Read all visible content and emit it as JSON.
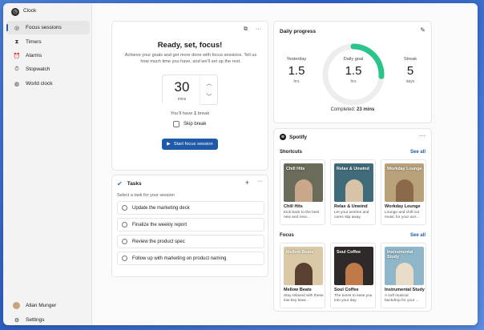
{
  "app": {
    "title": "Clock"
  },
  "window_controls": {
    "minimize": "–",
    "maximize": "□",
    "close": "✕"
  },
  "sidebar": {
    "items": [
      {
        "label": "Focus sessions",
        "icon": "focus-icon",
        "active": true
      },
      {
        "label": "Timers",
        "icon": "timer-icon"
      },
      {
        "label": "Alarms",
        "icon": "alarm-icon"
      },
      {
        "label": "Stopwatch",
        "icon": "stopwatch-icon"
      },
      {
        "label": "World clock",
        "icon": "globe-icon"
      }
    ],
    "user": {
      "name": "Allan Munger"
    },
    "settings_label": "Settings"
  },
  "focus": {
    "title": "Ready, set, focus!",
    "description": "Achieve your goals and get more done with focus sessions. Tell us how much time you have, and we'll set up the rest.",
    "duration_value": "30",
    "duration_unit": "mins",
    "break_text_prefix": "You'll have ",
    "break_count": "1",
    "break_text_suffix": " break",
    "skip_break_label": "Skip break",
    "start_label": "Start focus session"
  },
  "tasks": {
    "title": "Tasks",
    "subtitle": "Select a task for your session",
    "items": [
      "Update the marketing deck",
      "Finalize the weekly report",
      "Review the product spec",
      "Follow up with marketing on product naming"
    ]
  },
  "progress": {
    "title": "Daily progress",
    "yesterday_label": "Yesterday",
    "yesterday_value": "1.5",
    "yesterday_unit": "hrs",
    "goal_label": "Daily goal",
    "goal_value": "1.5",
    "goal_unit": "hrs",
    "streak_label": "Streak",
    "streak_value": "5",
    "streak_unit": "days",
    "completed_prefix": "Completed: ",
    "completed_value": "23 mins",
    "goal_fraction": 0.26,
    "ring_color": "#2bc48a"
  },
  "spotify": {
    "brand": "Spotify",
    "shortcuts_label": "Shortcuts",
    "focus_label": "Focus",
    "see_all": "See all",
    "shortcuts": [
      {
        "name": "Chill Hits",
        "art_title": "Chill Hits",
        "desc": "Kick back to the best new and rece...",
        "bg": "#6b6b5a",
        "fg": "#c9a78a"
      },
      {
        "name": "Relax & Unwind",
        "art_title": "Relax & Unwind",
        "desc": "Let your worries and cares slip away.",
        "bg": "#3f6b7a",
        "fg": "#d7c3a6"
      },
      {
        "name": "Workday Lounge",
        "art_title": "Workday Lounge",
        "desc": "Lounge and chill out music for your wor...",
        "bg": "#b9a27a",
        "fg": "#8a6a4a"
      }
    ],
    "focus_items": [
      {
        "name": "Mellow Beats",
        "art_title": "Mellow Beats",
        "desc": "Stay relaxed with these low-key beat...",
        "bg": "#d9c9a6",
        "fg": "#5a4030"
      },
      {
        "name": "Soul Coffee",
        "art_title": "Soul Coffee",
        "desc": "The tunes to ease you into your day.",
        "bg": "#2e2a2a",
        "fg": "#c07a4a"
      },
      {
        "name": "Instrumental Study",
        "art_title": "Instrumental Study",
        "desc": "A soft musical backdrop for your ...",
        "bg": "#8fb6c9",
        "fg": "#e9ddc7"
      }
    ]
  }
}
